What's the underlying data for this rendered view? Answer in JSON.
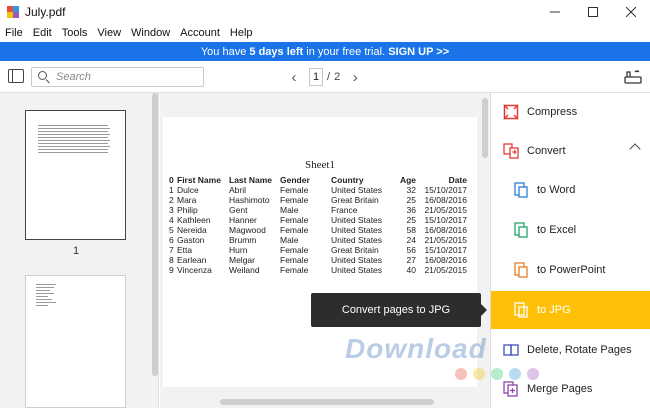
{
  "window": {
    "title": "July.pdf",
    "logo_colors": [
      "#e84c3d",
      "#3498db",
      "#f1c40f",
      "#9b59b6"
    ]
  },
  "menu": [
    "File",
    "Edit",
    "Tools",
    "View",
    "Window",
    "Account",
    "Help"
  ],
  "banner": {
    "prefix": "You have ",
    "days": "5 days left",
    "middle": " in your free trial. ",
    "cta": "SIGN UP >>",
    "color": "#1a73e8"
  },
  "toolbar": {
    "search_placeholder": "Search",
    "current_page": "1",
    "page_sep": "/",
    "total_pages": "2"
  },
  "thumbnails": [
    {
      "label": "1",
      "selected": true
    },
    {
      "label": "",
      "selected": false
    }
  ],
  "sheet": {
    "title": "Sheet1",
    "headers": [
      "0",
      "First Name",
      "Last Name",
      "Gender",
      "Country",
      "Age",
      "Date"
    ],
    "rows": [
      [
        "1",
        "Dulce",
        "Abril",
        "Female",
        "United States",
        "32",
        "15/10/2017"
      ],
      [
        "2",
        "Mara",
        "Hashimoto",
        "Female",
        "Great Britain",
        "25",
        "16/08/2016"
      ],
      [
        "3",
        "Philip",
        "Gent",
        "Male",
        "France",
        "36",
        "21/05/2015"
      ],
      [
        "4",
        "Kathleen",
        "Hanner",
        "Female",
        "United States",
        "25",
        "15/10/2017"
      ],
      [
        "5",
        "Nereida",
        "Magwood",
        "Female",
        "United States",
        "58",
        "16/08/2016"
      ],
      [
        "6",
        "Gaston",
        "Brumm",
        "Male",
        "United States",
        "24",
        "21/05/2015"
      ],
      [
        "7",
        "Etta",
        "Hurn",
        "Female",
        "Great Britain",
        "56",
        "15/10/2017"
      ],
      [
        "8",
        "Earlean",
        "Melgar",
        "Female",
        "United States",
        "27",
        "16/08/2016"
      ],
      [
        "9",
        "Vincenza",
        "Weiland",
        "Female",
        "United States",
        "40",
        "21/05/2015"
      ]
    ]
  },
  "tooltip": "Convert pages to JPG",
  "tools": [
    {
      "name": "compress",
      "label": "Compress",
      "icon": "compress-icon",
      "color": "#e53935",
      "level": "main",
      "selected": false
    },
    {
      "name": "convert",
      "label": "Convert",
      "icon": "convert-icon",
      "color": "#e53935",
      "level": "main",
      "selected": false,
      "expanded": true
    },
    {
      "name": "to-word",
      "label": "to Word",
      "icon": "word-icon",
      "color": "#2b7cd3",
      "level": "sub",
      "selected": false
    },
    {
      "name": "to-excel",
      "label": "to Excel",
      "icon": "excel-icon",
      "color": "#21a366",
      "level": "sub",
      "selected": false
    },
    {
      "name": "to-powerpoint",
      "label": "to PowerPoint",
      "icon": "powerpoint-icon",
      "color": "#e67e22",
      "level": "sub",
      "selected": false
    },
    {
      "name": "to-jpg",
      "label": "to JPG",
      "icon": "jpg-icon",
      "color": "#ffffff",
      "level": "sub",
      "selected": true
    },
    {
      "name": "delete-rotate",
      "label": "Delete, Rotate Pages",
      "icon": "pages-icon",
      "color": "#3f51b5",
      "level": "main",
      "selected": false
    },
    {
      "name": "merge",
      "label": "Merge Pages",
      "icon": "merge-icon",
      "color": "#8e44ad",
      "level": "main",
      "selected": false
    }
  ],
  "selected_color": "#ffc107",
  "watermark": "Download",
  "watermark_dots": [
    "#e74c3c",
    "#f1c40f",
    "#2ecc71",
    "#3498db",
    "#9b59b6"
  ]
}
